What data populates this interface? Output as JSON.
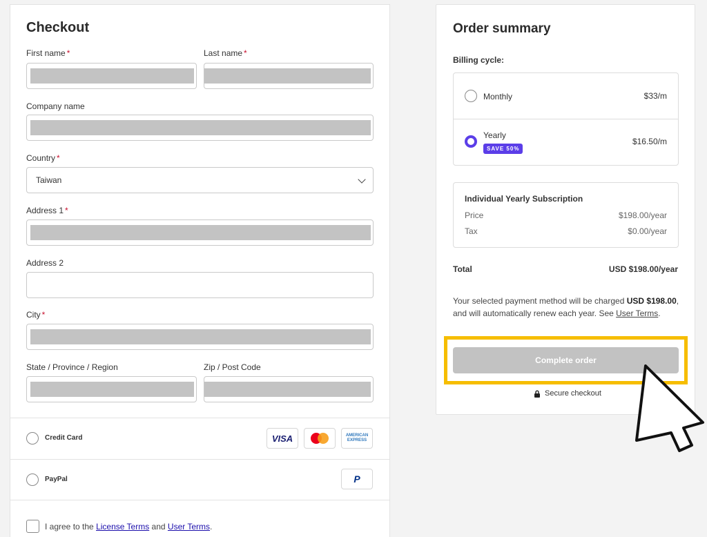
{
  "checkout": {
    "title": "Checkout",
    "required_mark": "*",
    "first_name": {
      "label": "First name",
      "required": true
    },
    "last_name": {
      "label": "Last name",
      "required": true
    },
    "company_name": {
      "label": "Company name"
    },
    "country": {
      "label": "Country",
      "value": "Taiwan"
    },
    "address1": {
      "label": "Address 1"
    },
    "address2": {
      "label": "Address 2"
    },
    "city": {
      "label": "City"
    },
    "state": {
      "label": "State / Province / Region"
    },
    "zip": {
      "label": "Zip / Post Code"
    },
    "payment": {
      "credit_card": {
        "label": "Credit Card",
        "logos": [
          "VISA",
          "mastercard",
          "AMERICAN EXPRESS"
        ]
      },
      "paypal": {
        "label": "PayPal",
        "logo": "P"
      }
    },
    "agree": {
      "prefix": "I agree to the ",
      "license_link": "License Terms",
      "middle": " and ",
      "user_link": "User Terms",
      "suffix": "."
    }
  },
  "summary": {
    "title": "Order summary",
    "billing_label": "Billing cycle:",
    "monthly": {
      "name": "Monthly",
      "price": "$33/m",
      "selected": false
    },
    "yearly": {
      "name": "Yearly",
      "price": "$16.50/m",
      "badge": "SAVE 50%",
      "selected": true
    },
    "subscription": {
      "title": "Individual Yearly Subscription",
      "price_label": "Price",
      "price_value": "$198.00/year",
      "tax_label": "Tax",
      "tax_value": "$0.00/year"
    },
    "total_label": "Total",
    "total_value": "USD $198.00/year",
    "notice": {
      "p1": "Your selected payment method will be charged ",
      "amount": "USD $198.00",
      "p2": ", and will automatically renew each year. See ",
      "link": "User Terms",
      "p3": "."
    },
    "complete_button": "Complete order",
    "secure_text": "Secure checkout"
  },
  "colors": {
    "accent": "#5b3ee8",
    "highlight": "#f6bd00",
    "required": "#c8102e",
    "button_disabled": "#c2c2c2"
  }
}
